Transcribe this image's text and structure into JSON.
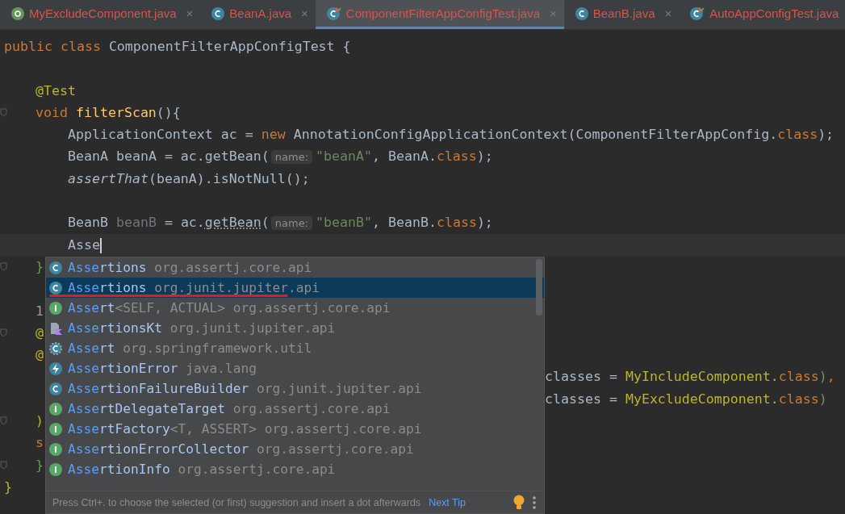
{
  "tabs": [
    {
      "label": "MyExcludeComponent.java",
      "kind": "annotation",
      "close": "×",
      "selected": false
    },
    {
      "label": "BeanA.java",
      "kind": "class",
      "close": "×",
      "selected": false
    },
    {
      "label": "ComponentFilterAppConfigTest.java",
      "kind": "test-class",
      "close": "×",
      "selected": true
    },
    {
      "label": "BeanB.java",
      "kind": "class",
      "close": "×",
      "selected": false
    },
    {
      "label": "AutoAppConfigTest.java",
      "kind": "test-class",
      "selected": false
    }
  ],
  "editor": {
    "lines": [
      {
        "kind": "top",
        "tokens": [
          {
            "text": "public class ",
            "kind": "keyword"
          },
          {
            "text": "ComponentFilterAppConfigTest {",
            "kind": "plain"
          }
        ]
      },
      {
        "kind": "blank"
      },
      {
        "kind": "member",
        "tokens": [
          {
            "text": "@Test",
            "kind": "annotation"
          }
        ]
      },
      {
        "kind": "member",
        "fold": true,
        "tokens": [
          {
            "text": "void ",
            "kind": "keyword"
          },
          {
            "text": "filterScan",
            "kind": "method"
          },
          {
            "text": "(){",
            "kind": "plain"
          }
        ]
      },
      {
        "kind": "body",
        "tokens": [
          {
            "text": "ApplicationContext ac = ",
            "kind": "plain"
          },
          {
            "text": "new ",
            "kind": "keyword"
          },
          {
            "text": "AnnotationConfigApplicationContext(ComponentFilterAppConfig.",
            "kind": "plain"
          },
          {
            "text": "class",
            "kind": "keyword"
          },
          {
            "text": ");",
            "kind": "plain"
          }
        ]
      },
      {
        "kind": "body",
        "tokens": [
          {
            "text": "BeanA beanA = ac.getBean(",
            "kind": "plain"
          },
          {
            "text": "name:",
            "kind": "hint"
          },
          {
            "text": "\"beanA\"",
            "kind": "string"
          },
          {
            "text": ", BeanA.",
            "kind": "plain"
          },
          {
            "text": "class",
            "kind": "keyword"
          },
          {
            "text": ");",
            "kind": "plain"
          }
        ]
      },
      {
        "kind": "body",
        "tokens": [
          {
            "text": "assertThat",
            "kind": "static"
          },
          {
            "text": "(beanA).isNotNull();",
            "kind": "plain"
          }
        ]
      },
      {
        "kind": "blank"
      },
      {
        "kind": "body",
        "tokens": [
          {
            "text": "BeanB ",
            "kind": "plain"
          },
          {
            "text": "beanB",
            "kind": "unused"
          },
          {
            "text": " = ac.",
            "kind": "plain"
          },
          {
            "text": "getBean",
            "kind": "warning"
          },
          {
            "text": "(",
            "kind": "plain"
          },
          {
            "text": "name:",
            "kind": "hint"
          },
          {
            "text": "\"beanB\"",
            "kind": "string"
          },
          {
            "text": ", BeanB.",
            "kind": "plain"
          },
          {
            "text": "class",
            "kind": "keyword"
          },
          {
            "text": ");",
            "kind": "plain"
          }
        ]
      },
      {
        "kind": "body",
        "current": true,
        "tokens": [
          {
            "text": "Asse",
            "kind": "plain"
          }
        ]
      },
      {
        "kind": "member",
        "fold": true,
        "tokens": [
          {
            "text": "}",
            "kind": "brace"
          }
        ]
      },
      {
        "kind": "blank"
      },
      {
        "kind": "member",
        "tokens": [
          {
            "text": "1",
            "kind": "usage"
          }
        ]
      },
      {
        "kind": "member",
        "fold": true,
        "tokens": [
          {
            "text": "@",
            "kind": "annotation"
          }
        ]
      },
      {
        "kind": "member",
        "tokens": [
          {
            "text": "@",
            "kind": "annotation"
          }
        ]
      },
      {
        "kind": "wrapped",
        "tokens": [
          {
            "text": "classes = ",
            "kind": "param"
          },
          {
            "text": "MyIncludeComponent.",
            "kind": "type"
          },
          {
            "text": "class",
            "kind": "keyword"
          },
          {
            "text": ")",
            "kind": "brace"
          },
          {
            "text": ",",
            "kind": "keyword"
          }
        ]
      },
      {
        "kind": "wrapped",
        "tokens": [
          {
            "text": "classes = ",
            "kind": "param"
          },
          {
            "text": "MyExcludeComponent.",
            "kind": "type"
          },
          {
            "text": "class",
            "kind": "keyword"
          },
          {
            "text": ")",
            "kind": "brace"
          }
        ]
      },
      {
        "kind": "member",
        "fold": true,
        "tokens": [
          {
            "text": ")",
            "kind": "annotation"
          }
        ]
      },
      {
        "kind": "member",
        "tokens": [
          {
            "text": "s",
            "kind": "keyword"
          }
        ]
      },
      {
        "kind": "member",
        "fold": true,
        "tokens": [
          {
            "text": "}",
            "kind": "brace"
          }
        ]
      },
      {
        "kind": "top",
        "tokens": [
          {
            "text": "}",
            "kind": "annotation"
          }
        ]
      }
    ]
  },
  "completion": {
    "items": [
      {
        "kind": "class",
        "match": "Asse",
        "rest": "rtions",
        "package": "org.assertj.core.api",
        "selected": false
      },
      {
        "kind": "class",
        "match": "Asse",
        "rest": "rtions",
        "package": "org.junit.jupiter.api",
        "selected": true
      },
      {
        "kind": "interface",
        "match": "Asse",
        "rest": "rt",
        "generic": "<SELF, ACTUAL>",
        "package": "org.assertj.core.api",
        "selected": false
      },
      {
        "kind": "kotlin-file",
        "match": "Asse",
        "rest": "rtionsKt",
        "package": "org.junit.jupiter.api",
        "selected": false
      },
      {
        "kind": "abstract-class",
        "match": "Asse",
        "rest": "rt",
        "package": "org.springframework.util",
        "selected": false
      },
      {
        "kind": "exception",
        "match": "Asse",
        "rest": "rtionError",
        "package": "java.lang",
        "selected": false
      },
      {
        "kind": "class",
        "match": "Asse",
        "rest": "rtionFailureBuilder",
        "package": "org.junit.jupiter.api",
        "selected": false
      },
      {
        "kind": "interface",
        "match": "Asse",
        "rest": "rtDelegateTarget",
        "package": "org.assertj.core.api",
        "selected": false
      },
      {
        "kind": "interface",
        "match": "Asse",
        "rest": "rtFactory",
        "generic": "<T, ASSERT>",
        "package": "org.assertj.core.api",
        "selected": false
      },
      {
        "kind": "interface",
        "match": "Asse",
        "rest": "rtionErrorCollector",
        "package": "org.assertj.core.api",
        "selected": false
      },
      {
        "kind": "interface",
        "match": "Asse",
        "rest": "rtionInfo",
        "package": "org.assertj.core.api",
        "selected": false
      }
    ],
    "tip": "Press Ctrl+. to choose the selected (or first) suggestion and insert a dot afterwards",
    "tip_link": "Next Tip"
  }
}
